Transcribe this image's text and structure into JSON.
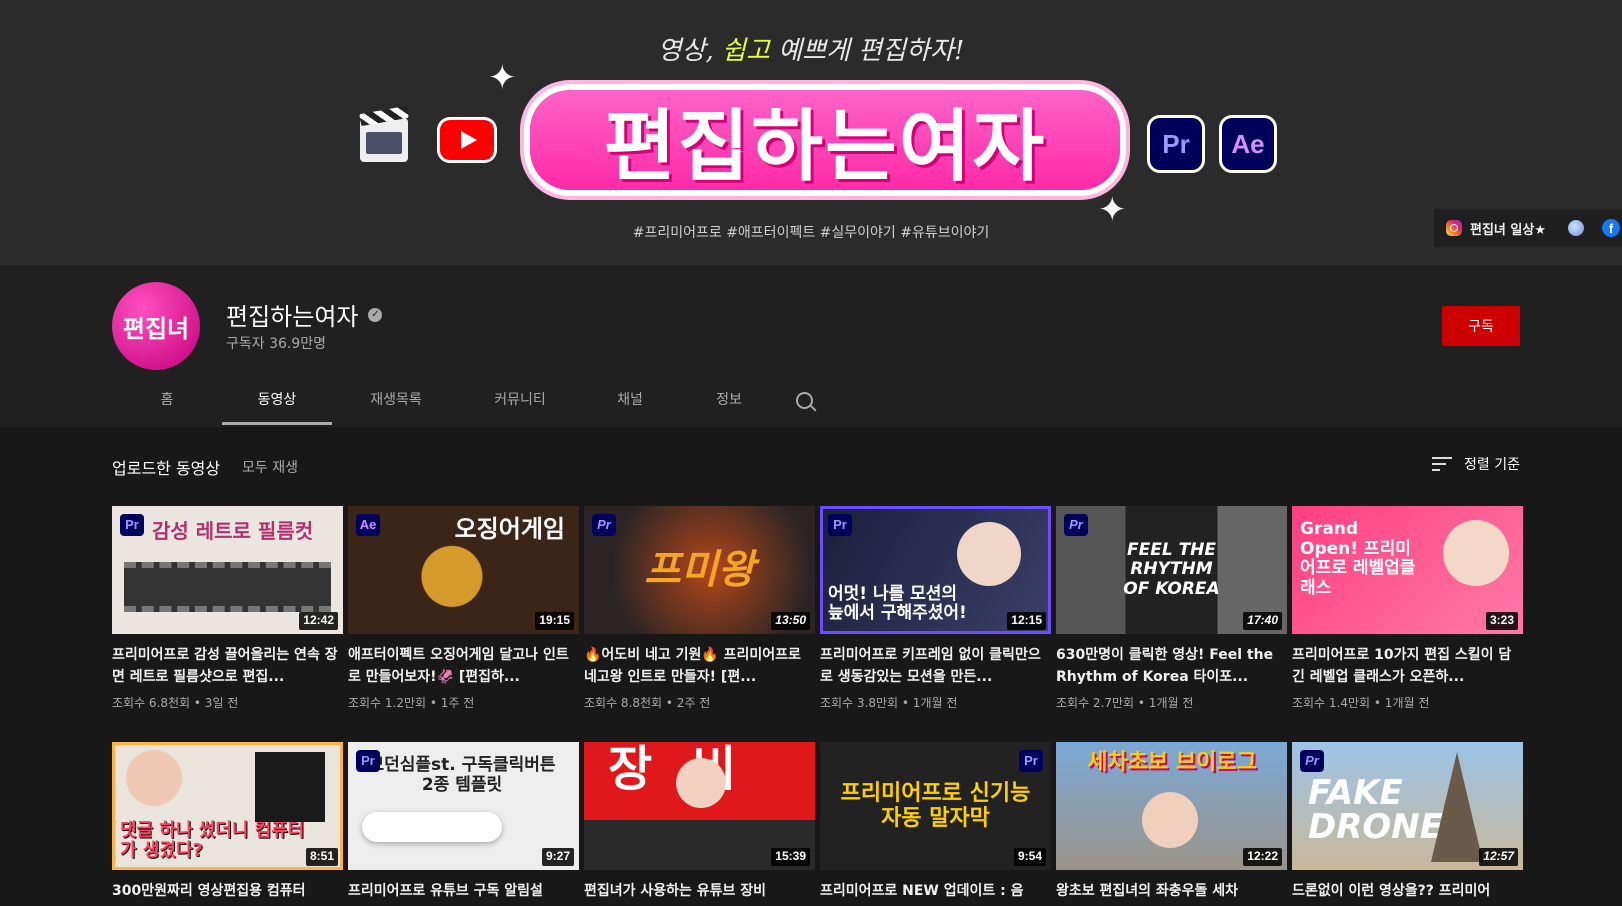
{
  "banner": {
    "tagline_a": "영상, ",
    "tagline_b": "쉽고",
    "tagline_c": " 예쁘게 편집하자!",
    "title": "편집하는여자",
    "pr_label": "Pr",
    "ae_label": "Ae",
    "hashtags": "#프리미어프로  #애프터이펙트  #실무이야기  #유튜브이야기",
    "link_label": "편집녀 일상★",
    "fb_glyph": "f"
  },
  "channel": {
    "avatar_text": "편집녀",
    "name": "편집하는여자",
    "verified_glyph": "✓",
    "subscribers": "구독자 36.9만명",
    "subscribe_label": "구독"
  },
  "tabs": [
    "홈",
    "동영상",
    "재생목록",
    "커뮤니티",
    "채널",
    "정보"
  ],
  "section": {
    "title": "업로드한 동영상",
    "play_all": "모두 재생",
    "sort_label": "정렬 기준"
  },
  "videos": [
    {
      "badge": "Pr",
      "thumb_text": "감성 레트로 필름컷",
      "duration": "12:42",
      "title": "프리미어프로 감성 끌어올리는 연속 장면 레트로 필름샷으로 편집...",
      "meta": "조회수 6.8천회 • 3일 전"
    },
    {
      "badge": "Ae",
      "thumb_text": "오징어게임",
      "duration": "19:15",
      "title": "애프터이펙트 오징어게임 달고나 인트로 만들어보자!🦑 [편집하...",
      "meta": "조회수 1.2만회 • 1주 전"
    },
    {
      "badge": "Pr",
      "thumb_text": "프미왕",
      "duration": "13:50",
      "title": "🔥어도비 네고 기원🔥 프리미어프로 네고왕 인트로 만들자! [편...",
      "meta": "조회수 8.8천회 • 2주 전"
    },
    {
      "badge": "Pr",
      "thumb_text": "어멋! 나를 모션의 늪에서 구해주셨어!",
      "duration": "12:15",
      "title": "프리미어프로 키프레임 없이 클릭만으로 생동감있는 모션을 만든...",
      "meta": "조회수 3.8만회 • 1개월 전"
    },
    {
      "badge": "Pr",
      "thumb_text": "FEEL THE RHYTHM OF KOREA",
      "duration": "17:40",
      "title": "630만명이 클릭한 영상! Feel the Rhythm of Korea 타이포...",
      "meta": "조회수 2.7만회 • 1개월 전"
    },
    {
      "badge": "",
      "thumb_text": "Grand Open! 프리미어프로 레벨업클래스",
      "duration": "3:23",
      "title": "프리미어프로 10가지 편집 스킬이 담긴 레벨업 클래스가 오픈하...",
      "meta": "조회수 1.4만회 • 1개월 전"
    },
    {
      "badge": "",
      "thumb_text": "댓글 하나 썼더니 컴퓨터가 생겼다?",
      "duration": "8:51",
      "title": "300만원짜리 영상편집용 컴퓨터",
      "meta": ""
    },
    {
      "badge": "Pr",
      "thumb_text": "모던심플st. 구독클릭버튼 2종 템플릿",
      "duration": "9:27",
      "title": "프리미어프로 유튜브 구독 알림설",
      "meta": ""
    },
    {
      "badge": "",
      "thumb_text": "장비",
      "duration": "15:39",
      "title": "편집녀가 사용하는 유튜브 장비",
      "meta": ""
    },
    {
      "badge": "Pr",
      "thumb_text": "프리미어프로 신기능 자동 말자막",
      "duration": "9:54",
      "title": "프리미어프로 NEW 업데이트 : 음",
      "meta": ""
    },
    {
      "badge": "",
      "thumb_text": "세차초보 브이로그",
      "duration": "12:22",
      "title": "왕초보 편집녀의 좌충우돌 세차",
      "meta": ""
    },
    {
      "badge": "Pr",
      "thumb_text": "FAKE DRONE",
      "duration": "12:57",
      "title": "드론없이 이런 영상을?? 프리미어",
      "meta": ""
    }
  ],
  "colors": {
    "brand_pink": "#ff2aa8",
    "subscribe_red": "#cc0000",
    "premiere_bg": "#00005b",
    "page_bg": "#181818"
  }
}
